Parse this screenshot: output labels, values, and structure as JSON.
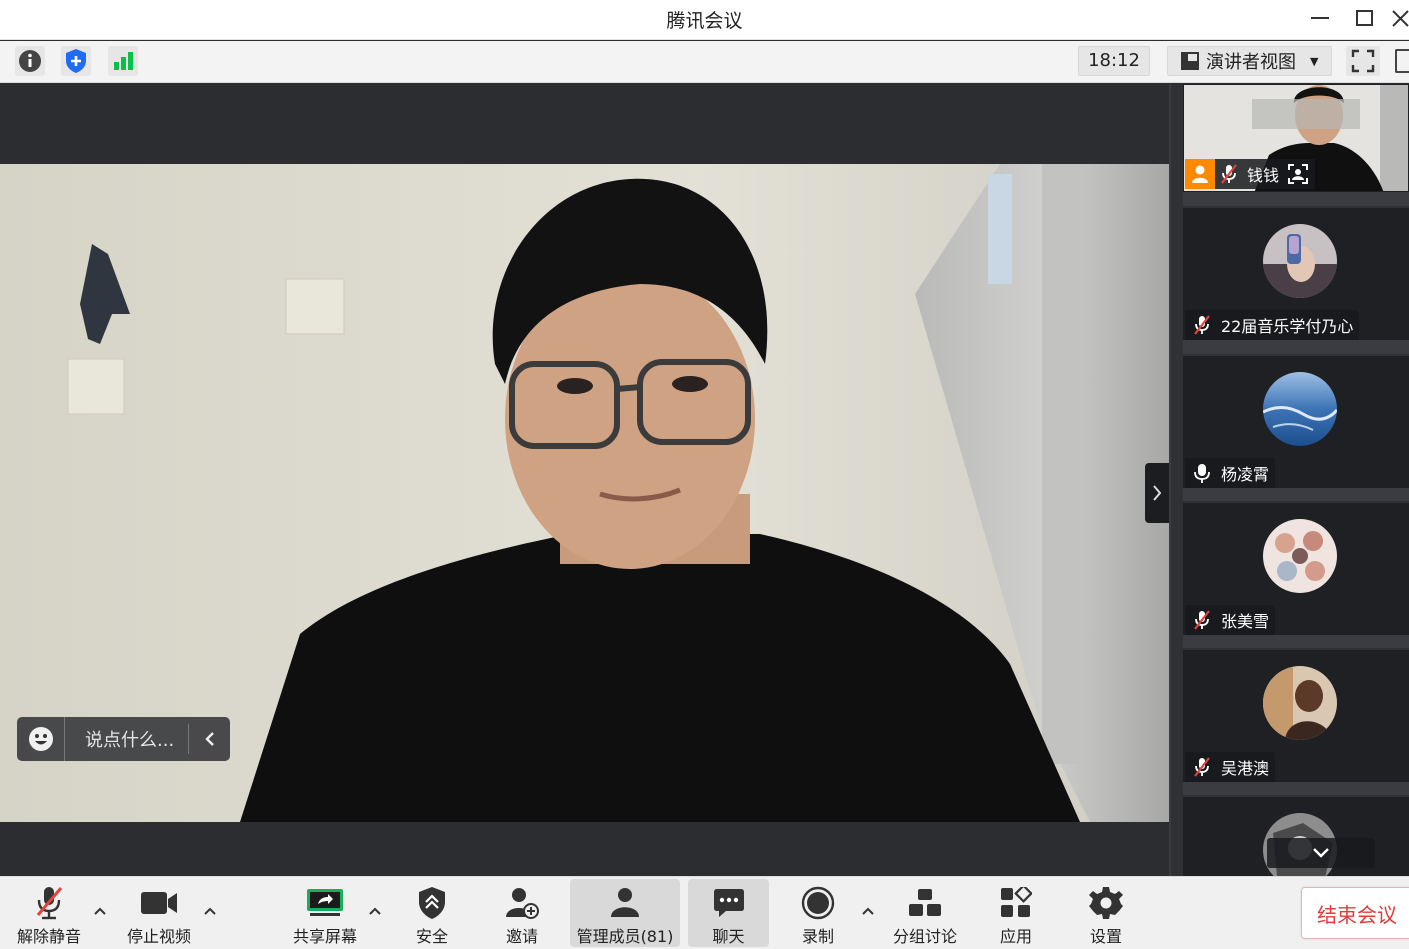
{
  "window": {
    "title": "腾讯会议"
  },
  "toolbar": {
    "time": "18:12",
    "view_label": "演讲者视图"
  },
  "main": {
    "chat_placeholder": "说点什么..."
  },
  "participants": {
    "self_name": "钱钱",
    "tiles": [
      {
        "name": "22届音乐学付乃心",
        "mic": "muted"
      },
      {
        "name": "杨凌霄",
        "mic": "on"
      },
      {
        "name": "张美雪",
        "mic": "muted"
      },
      {
        "name": "吴港澳",
        "mic": "muted"
      }
    ]
  },
  "controls": {
    "unmute": "解除静音",
    "stop_video": "停止视频",
    "share_screen": "共享屏幕",
    "security": "安全",
    "invite": "邀请",
    "manage_members": "管理成员(81)",
    "chat": "聊天",
    "record": "录制",
    "breakout": "分组讨论",
    "apps": "应用",
    "settings": "设置",
    "end_meeting": "结束会议"
  },
  "colors": {
    "share_green": "#1aad5b",
    "signal_green": "#0bbf4a",
    "shield_blue": "#1d6cf2",
    "end_red": "#e03c3c",
    "host_orange": "#ff8a00"
  }
}
